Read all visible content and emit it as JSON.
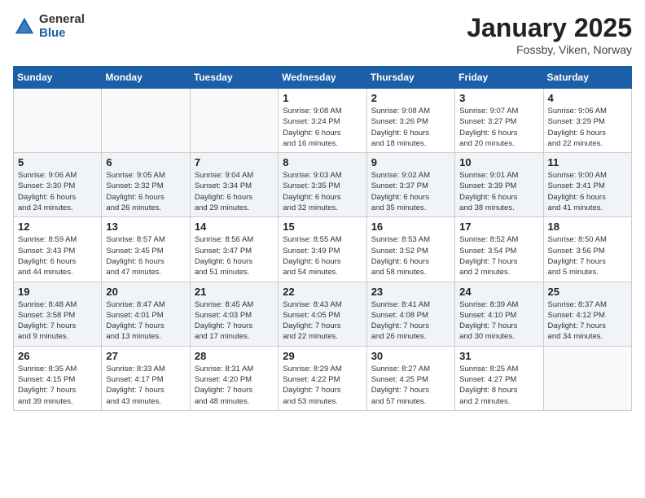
{
  "header": {
    "logo_general": "General",
    "logo_blue": "Blue",
    "month_title": "January 2025",
    "location": "Fossby, Viken, Norway"
  },
  "weekdays": [
    "Sunday",
    "Monday",
    "Tuesday",
    "Wednesday",
    "Thursday",
    "Friday",
    "Saturday"
  ],
  "weeks": [
    [
      {
        "day": "",
        "info": ""
      },
      {
        "day": "",
        "info": ""
      },
      {
        "day": "",
        "info": ""
      },
      {
        "day": "1",
        "info": "Sunrise: 9:08 AM\nSunset: 3:24 PM\nDaylight: 6 hours\nand 16 minutes."
      },
      {
        "day": "2",
        "info": "Sunrise: 9:08 AM\nSunset: 3:26 PM\nDaylight: 6 hours\nand 18 minutes."
      },
      {
        "day": "3",
        "info": "Sunrise: 9:07 AM\nSunset: 3:27 PM\nDaylight: 6 hours\nand 20 minutes."
      },
      {
        "day": "4",
        "info": "Sunrise: 9:06 AM\nSunset: 3:29 PM\nDaylight: 6 hours\nand 22 minutes."
      }
    ],
    [
      {
        "day": "5",
        "info": "Sunrise: 9:06 AM\nSunset: 3:30 PM\nDaylight: 6 hours\nand 24 minutes."
      },
      {
        "day": "6",
        "info": "Sunrise: 9:05 AM\nSunset: 3:32 PM\nDaylight: 6 hours\nand 26 minutes."
      },
      {
        "day": "7",
        "info": "Sunrise: 9:04 AM\nSunset: 3:34 PM\nDaylight: 6 hours\nand 29 minutes."
      },
      {
        "day": "8",
        "info": "Sunrise: 9:03 AM\nSunset: 3:35 PM\nDaylight: 6 hours\nand 32 minutes."
      },
      {
        "day": "9",
        "info": "Sunrise: 9:02 AM\nSunset: 3:37 PM\nDaylight: 6 hours\nand 35 minutes."
      },
      {
        "day": "10",
        "info": "Sunrise: 9:01 AM\nSunset: 3:39 PM\nDaylight: 6 hours\nand 38 minutes."
      },
      {
        "day": "11",
        "info": "Sunrise: 9:00 AM\nSunset: 3:41 PM\nDaylight: 6 hours\nand 41 minutes."
      }
    ],
    [
      {
        "day": "12",
        "info": "Sunrise: 8:59 AM\nSunset: 3:43 PM\nDaylight: 6 hours\nand 44 minutes."
      },
      {
        "day": "13",
        "info": "Sunrise: 8:57 AM\nSunset: 3:45 PM\nDaylight: 6 hours\nand 47 minutes."
      },
      {
        "day": "14",
        "info": "Sunrise: 8:56 AM\nSunset: 3:47 PM\nDaylight: 6 hours\nand 51 minutes."
      },
      {
        "day": "15",
        "info": "Sunrise: 8:55 AM\nSunset: 3:49 PM\nDaylight: 6 hours\nand 54 minutes."
      },
      {
        "day": "16",
        "info": "Sunrise: 8:53 AM\nSunset: 3:52 PM\nDaylight: 6 hours\nand 58 minutes."
      },
      {
        "day": "17",
        "info": "Sunrise: 8:52 AM\nSunset: 3:54 PM\nDaylight: 7 hours\nand 2 minutes."
      },
      {
        "day": "18",
        "info": "Sunrise: 8:50 AM\nSunset: 3:56 PM\nDaylight: 7 hours\nand 5 minutes."
      }
    ],
    [
      {
        "day": "19",
        "info": "Sunrise: 8:48 AM\nSunset: 3:58 PM\nDaylight: 7 hours\nand 9 minutes."
      },
      {
        "day": "20",
        "info": "Sunrise: 8:47 AM\nSunset: 4:01 PM\nDaylight: 7 hours\nand 13 minutes."
      },
      {
        "day": "21",
        "info": "Sunrise: 8:45 AM\nSunset: 4:03 PM\nDaylight: 7 hours\nand 17 minutes."
      },
      {
        "day": "22",
        "info": "Sunrise: 8:43 AM\nSunset: 4:05 PM\nDaylight: 7 hours\nand 22 minutes."
      },
      {
        "day": "23",
        "info": "Sunrise: 8:41 AM\nSunset: 4:08 PM\nDaylight: 7 hours\nand 26 minutes."
      },
      {
        "day": "24",
        "info": "Sunrise: 8:39 AM\nSunset: 4:10 PM\nDaylight: 7 hours\nand 30 minutes."
      },
      {
        "day": "25",
        "info": "Sunrise: 8:37 AM\nSunset: 4:12 PM\nDaylight: 7 hours\nand 34 minutes."
      }
    ],
    [
      {
        "day": "26",
        "info": "Sunrise: 8:35 AM\nSunset: 4:15 PM\nDaylight: 7 hours\nand 39 minutes."
      },
      {
        "day": "27",
        "info": "Sunrise: 8:33 AM\nSunset: 4:17 PM\nDaylight: 7 hours\nand 43 minutes."
      },
      {
        "day": "28",
        "info": "Sunrise: 8:31 AM\nSunset: 4:20 PM\nDaylight: 7 hours\nand 48 minutes."
      },
      {
        "day": "29",
        "info": "Sunrise: 8:29 AM\nSunset: 4:22 PM\nDaylight: 7 hours\nand 53 minutes."
      },
      {
        "day": "30",
        "info": "Sunrise: 8:27 AM\nSunset: 4:25 PM\nDaylight: 7 hours\nand 57 minutes."
      },
      {
        "day": "31",
        "info": "Sunrise: 8:25 AM\nSunset: 4:27 PM\nDaylight: 8 hours\nand 2 minutes."
      },
      {
        "day": "",
        "info": ""
      }
    ]
  ]
}
